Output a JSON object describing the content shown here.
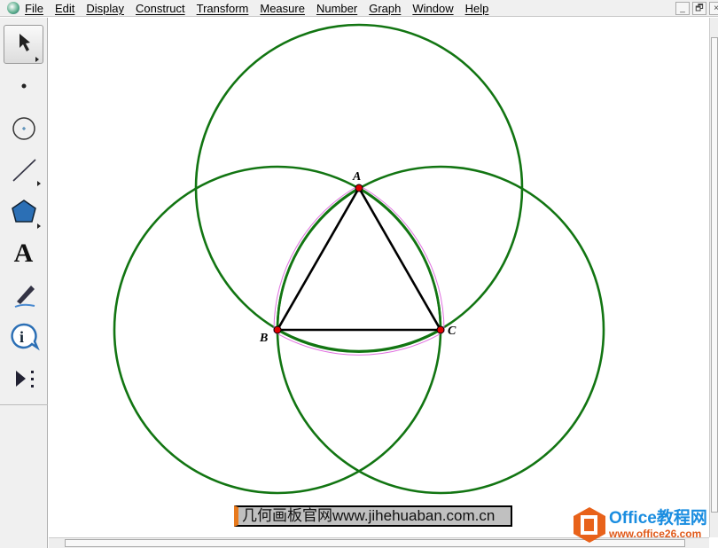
{
  "menu": [
    "File",
    "Edit",
    "Display",
    "Construct",
    "Transform",
    "Measure",
    "Number",
    "Graph",
    "Window",
    "Help"
  ],
  "window_buttons": [
    "_",
    "🗗",
    "×"
  ],
  "tools": [
    "arrow-tool",
    "point-tool",
    "compass-tool",
    "straightedge-tool",
    "polygon-tool",
    "text-tool",
    "marker-tool",
    "information-tool",
    "custom-tool"
  ],
  "text_tool_glyph": "A",
  "info_tool_glyph": "i",
  "points": {
    "A": "A",
    "B": "B",
    "C": "C"
  },
  "colors": {
    "circle": "#127512",
    "point": "#e00000",
    "arc_highlight": "#e070e0"
  },
  "caption": "几何画板官网www.jihehuaban.com.cn",
  "watermark": {
    "title": "Office教程网",
    "url": "www.office26.com"
  }
}
